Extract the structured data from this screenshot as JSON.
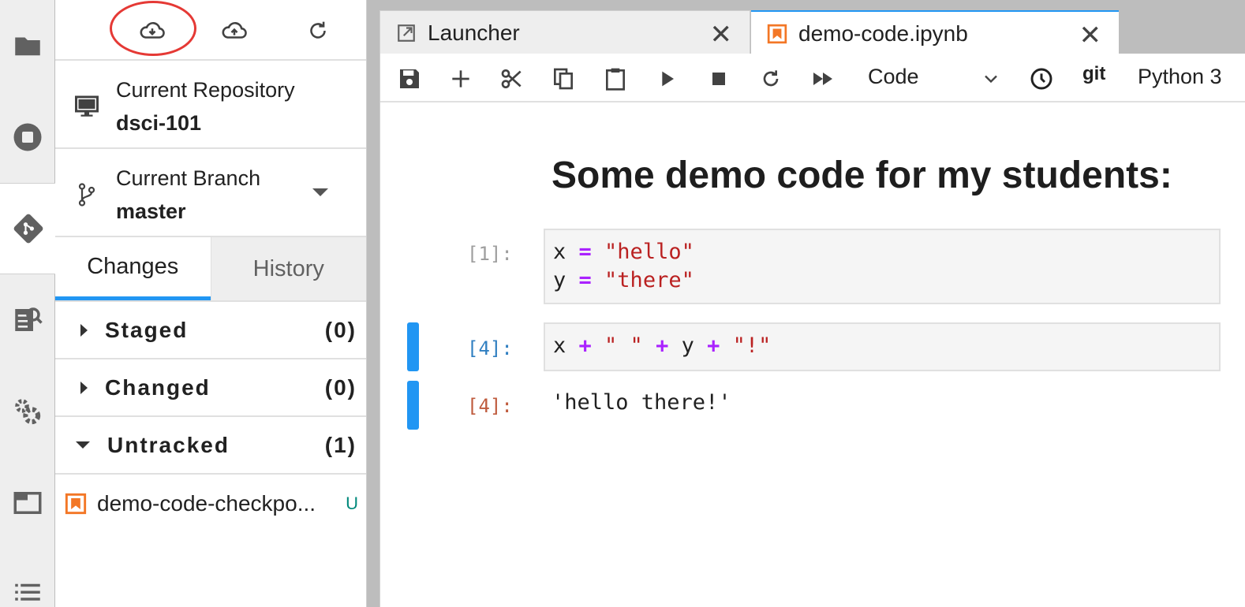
{
  "activity_bar": {
    "items": [
      {
        "icon": "folder-icon",
        "active": false
      },
      {
        "icon": "stop-circle-icon",
        "active": false
      },
      {
        "icon": "git-icon",
        "active": true
      },
      {
        "icon": "property-inspector-icon",
        "active": false
      },
      {
        "icon": "settings-gears-icon",
        "active": false
      },
      {
        "icon": "tabs-icon",
        "active": false
      },
      {
        "icon": "list-icon",
        "active": false
      }
    ]
  },
  "git_panel": {
    "toolbar": {
      "pull_icon": "cloud-download-icon",
      "push_icon": "cloud-upload-icon",
      "refresh_icon": "refresh-icon",
      "highlight_color": "#e53935"
    },
    "repository": {
      "label": "Current Repository",
      "value": "dsci-101"
    },
    "branch": {
      "label": "Current Branch",
      "value": "master"
    },
    "tabs": [
      {
        "label": "Changes",
        "active": true
      },
      {
        "label": "History",
        "active": false
      }
    ],
    "sections": [
      {
        "label": "Staged",
        "count": "(0)",
        "expanded": false
      },
      {
        "label": "Changed",
        "count": "(0)",
        "expanded": false
      },
      {
        "label": "Untracked",
        "count": "(1)",
        "expanded": true
      }
    ],
    "untracked_files": [
      {
        "name": "demo-code-checkpo...",
        "status": "U"
      }
    ]
  },
  "doc_tabs": [
    {
      "label": "Launcher",
      "icon": "launcher-icon",
      "active": false
    },
    {
      "label": "demo-code.ipynb",
      "icon": "notebook-icon",
      "active": true
    }
  ],
  "notebook": {
    "toolbar": {
      "cell_type": "Code",
      "git_label": "git",
      "kernel": "Python 3"
    },
    "markdown_title": "Some demo code for my students:",
    "cells": [
      {
        "prompt": "[1]:",
        "lines": [
          [
            {
              "t": "x ",
              "c": "var"
            },
            {
              "t": "=",
              "c": "op"
            },
            {
              "t": " ",
              "c": "var"
            },
            {
              "t": "\"hello\"",
              "c": "str"
            }
          ],
          [
            {
              "t": "y ",
              "c": "var"
            },
            {
              "t": "=",
              "c": "op"
            },
            {
              "t": " ",
              "c": "var"
            },
            {
              "t": "\"there\"",
              "c": "str"
            }
          ]
        ]
      },
      {
        "prompt": "[4]:",
        "lines": [
          [
            {
              "t": "x ",
              "c": "var"
            },
            {
              "t": "+",
              "c": "op"
            },
            {
              "t": " ",
              "c": "var"
            },
            {
              "t": "\" \"",
              "c": "str"
            },
            {
              "t": " ",
              "c": "var"
            },
            {
              "t": "+",
              "c": "op"
            },
            {
              "t": " y ",
              "c": "var"
            },
            {
              "t": "+",
              "c": "op"
            },
            {
              "t": " ",
              "c": "var"
            },
            {
              "t": "\"!\"",
              "c": "str"
            }
          ]
        ]
      }
    ],
    "output": {
      "prompt": "[4]:",
      "text": "'hello there!'"
    }
  },
  "colors": {
    "accent": "#2196f3",
    "notebook_orange": "#f37726",
    "untracked_status": "#00897b"
  }
}
